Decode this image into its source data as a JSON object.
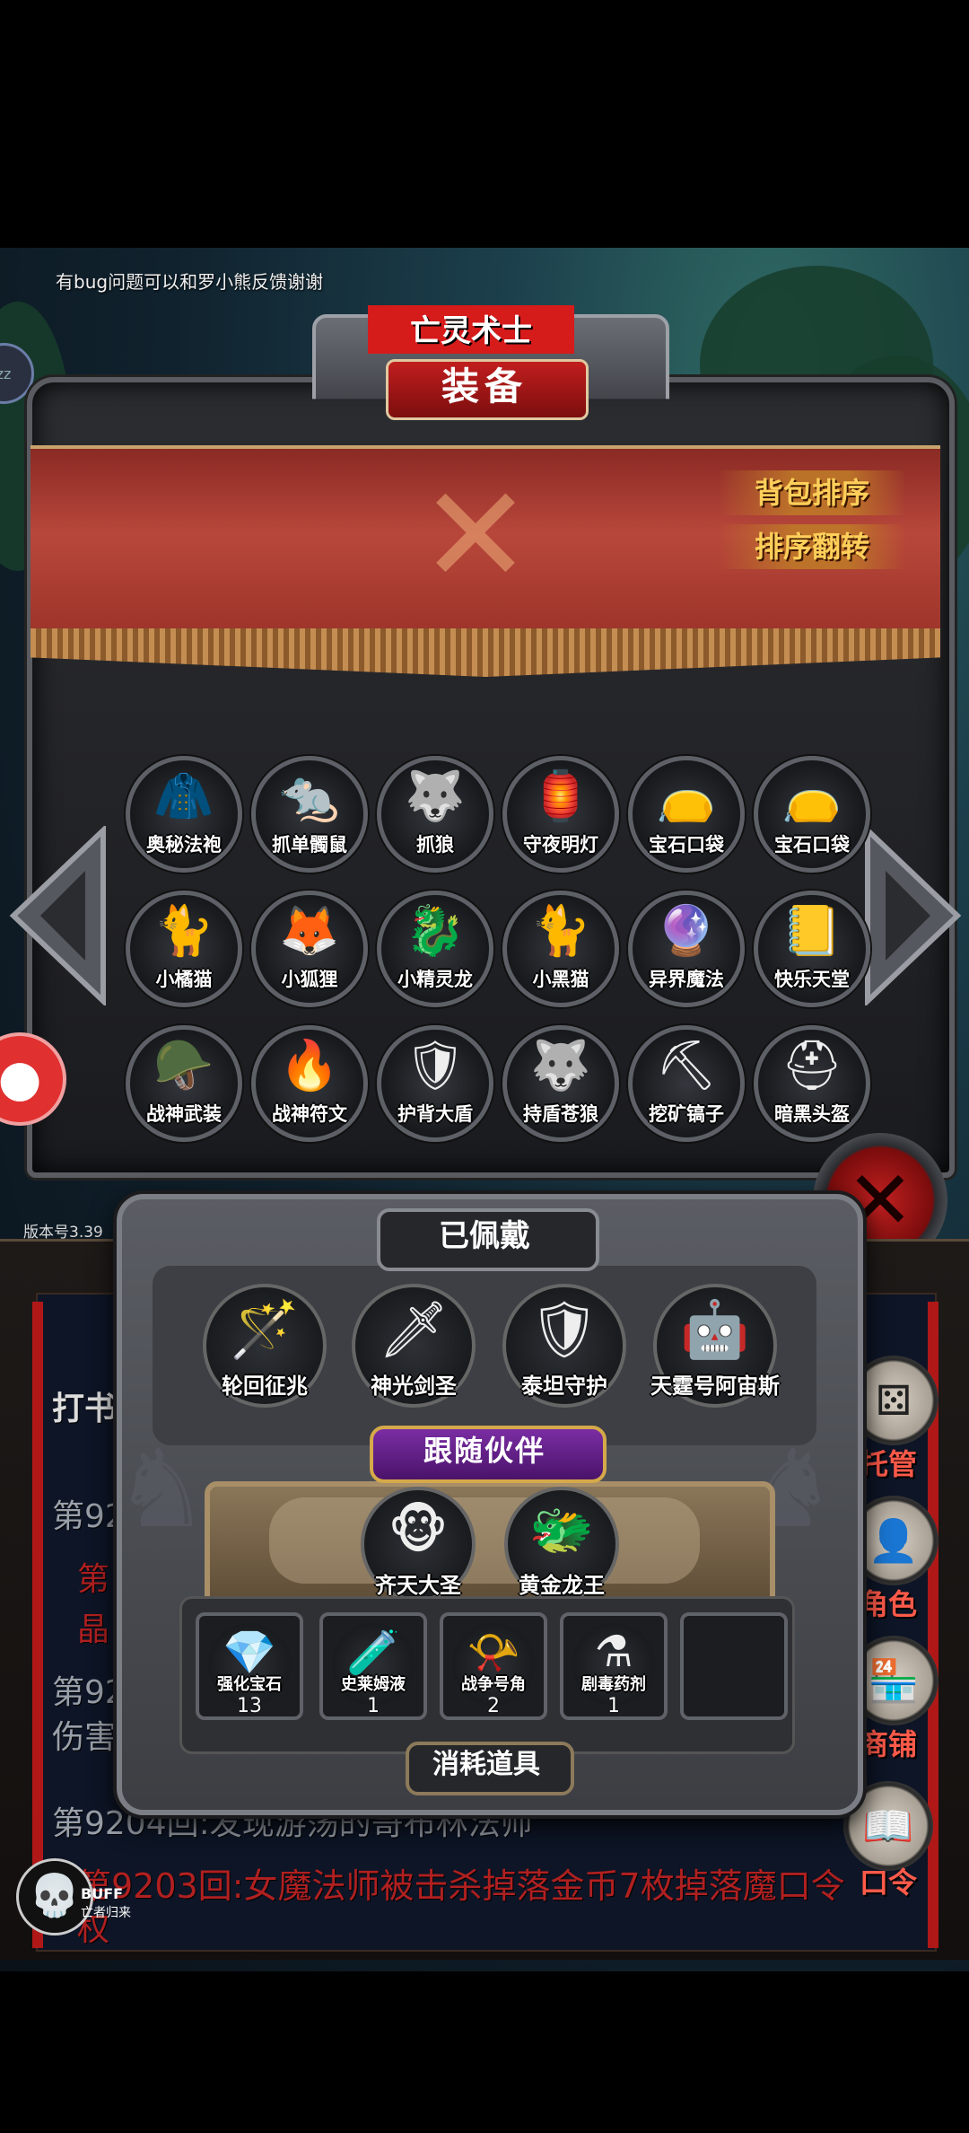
{
  "bug_note": "有bug问题可以和罗小熊反馈谢谢",
  "zz_icon": "zz",
  "character_name": "亡灵术士",
  "equip_title": "装备",
  "banner_buttons": {
    "sort": "背包排序",
    "reverse": "排序翻转"
  },
  "inventory": [
    {
      "label": "奥秘法袍",
      "icon": "🧥"
    },
    {
      "label": "抓单髑鼠",
      "icon": "🐀"
    },
    {
      "label": "抓狼",
      "icon": "🐺"
    },
    {
      "label": "守夜明灯",
      "icon": "🏮"
    },
    {
      "label": "宝石口袋",
      "icon": "👝"
    },
    {
      "label": "宝石口袋",
      "icon": "👝"
    },
    {
      "label": "小橘猫",
      "icon": "🐈"
    },
    {
      "label": "小狐狸",
      "icon": "🦊"
    },
    {
      "label": "小精灵龙",
      "icon": "🐉"
    },
    {
      "label": "小黑猫",
      "icon": "🐈"
    },
    {
      "label": "异界魔法",
      "icon": "🔮"
    },
    {
      "label": "快乐天堂",
      "icon": "📒"
    },
    {
      "label": "战神武装",
      "icon": "🪖"
    },
    {
      "label": "战神符文",
      "icon": "🔥"
    },
    {
      "label": "护背大盾",
      "icon": "🛡"
    },
    {
      "label": "持盾苍狼",
      "icon": "🐺"
    },
    {
      "label": "挖矿镐子",
      "icon": "⛏"
    },
    {
      "label": "暗黑头盔",
      "icon": "⛑"
    }
  ],
  "version": "版本号3.39",
  "log": {
    "title": "打书",
    "lines": [
      {
        "text": "第920"
      },
      {
        "text": "第"
      },
      {
        "text": "晶"
      },
      {
        "text": "第92"
      },
      {
        "text": "伤害"
      },
      {
        "text": "第9204回:发现游荡的哥布林法师"
      },
      {
        "text": "第9203回:女魔法师被击杀掉落金币7枚掉落魔口令"
      },
      {
        "text": "权"
      }
    ]
  },
  "side_buttons": [
    {
      "label": "托管",
      "icon": "⚄"
    },
    {
      "label": "角色",
      "icon": "👤"
    },
    {
      "label": "商铺",
      "icon": "🏪"
    },
    {
      "label": "口令",
      "icon": "📖"
    }
  ],
  "equipped": {
    "title": "已佩戴",
    "items": [
      {
        "label": "轮回征兆",
        "icon": "🪄"
      },
      {
        "label": "神光剑圣",
        "icon": "🗡"
      },
      {
        "label": "泰坦守护",
        "icon": "🛡"
      },
      {
        "label": "天霆号阿宙斯",
        "icon": "🤖"
      }
    ]
  },
  "companion": {
    "title": "跟随伙伴",
    "items": [
      {
        "label": "齐天大圣",
        "icon": "🐵"
      },
      {
        "label": "黄金龙王",
        "icon": "🐲"
      }
    ]
  },
  "consumables": {
    "title": "消耗道具",
    "items": [
      {
        "label": "强化宝石",
        "icon": "💎",
        "count": "13"
      },
      {
        "label": "史莱姆液",
        "icon": "🧪",
        "count": "1"
      },
      {
        "label": "战争号角",
        "icon": "📯",
        "count": "2"
      },
      {
        "label": "剧毒药剂",
        "icon": "⚗",
        "count": "1"
      },
      {
        "label": "",
        "icon": "",
        "count": ""
      }
    ]
  },
  "buff": {
    "label": "BUFF",
    "sub": "亡者归来",
    "icon": "💀"
  },
  "colors": {
    "banner_red": "#b8473b",
    "title_red": "#d61b1b",
    "gold_text": "#ffcf5a",
    "log_red": "#b02020",
    "purple": "#7a2da3"
  }
}
